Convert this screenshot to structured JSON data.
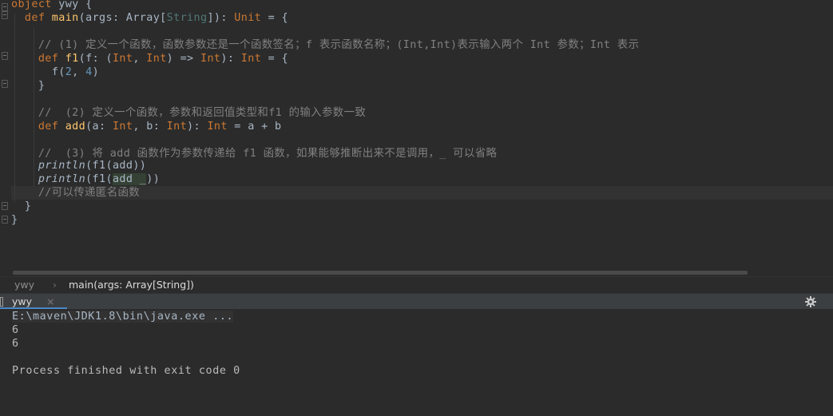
{
  "editor": {
    "lines": [
      {
        "segments": [
          {
            "t": "object",
            "c": "kw"
          },
          {
            "t": " ywy {",
            "c": "ty"
          }
        ]
      },
      {
        "segments": [
          {
            "t": "  def ",
            "c": "kw"
          },
          {
            "t": "main",
            "c": "fn"
          },
          {
            "t": "(args: Array[",
            "c": "ty"
          },
          {
            "t": "String",
            "c": "tp"
          },
          {
            "t": "]): ",
            "c": "ty"
          },
          {
            "t": "Unit",
            "c": "kw"
          },
          {
            "t": " = {",
            "c": "ty"
          }
        ]
      },
      {
        "segments": []
      },
      {
        "segments": [
          {
            "t": "    // (1) 定义一个函数，函数参数还是一个函数签名；f 表示函数名称；(Int,Int)表示输入两个 Int 参数；Int 表示",
            "c": "cm"
          }
        ]
      },
      {
        "segments": [
          {
            "t": "    def ",
            "c": "kw"
          },
          {
            "t": "f1",
            "c": "fn"
          },
          {
            "t": "(f: (",
            "c": "ty"
          },
          {
            "t": "Int",
            "c": "kw"
          },
          {
            "t": ", ",
            "c": "ty"
          },
          {
            "t": "Int",
            "c": "kw"
          },
          {
            "t": ") => ",
            "c": "ty"
          },
          {
            "t": "Int",
            "c": "kw"
          },
          {
            "t": "): ",
            "c": "ty"
          },
          {
            "t": "Int",
            "c": "kw"
          },
          {
            "t": " = {",
            "c": "ty"
          }
        ]
      },
      {
        "segments": [
          {
            "t": "      f(",
            "c": "ty"
          },
          {
            "t": "2",
            "c": "num"
          },
          {
            "t": ", ",
            "c": "ty"
          },
          {
            "t": "4",
            "c": "num"
          },
          {
            "t": ")",
            "c": "ty"
          }
        ]
      },
      {
        "segments": [
          {
            "t": "    }",
            "c": "ty"
          }
        ]
      },
      {
        "segments": []
      },
      {
        "segments": [
          {
            "t": "    //  (2) 定义一个函数，参数和返回值类型和f1 的输入参数一致",
            "c": "cm"
          }
        ]
      },
      {
        "segments": [
          {
            "t": "    def ",
            "c": "kw"
          },
          {
            "t": "add",
            "c": "fn"
          },
          {
            "t": "(a: ",
            "c": "ty"
          },
          {
            "t": "Int",
            "c": "kw"
          },
          {
            "t": ", b: ",
            "c": "ty"
          },
          {
            "t": "Int",
            "c": "kw"
          },
          {
            "t": "): ",
            "c": "ty"
          },
          {
            "t": "Int",
            "c": "kw"
          },
          {
            "t": " = a + b",
            "c": "ty"
          }
        ]
      },
      {
        "segments": []
      },
      {
        "segments": [
          {
            "t": "    //  (3) 将 add 函数作为参数传递给 f1 函数，如果能够推断出来不是调用，_ 可以省略",
            "c": "cm"
          }
        ]
      },
      {
        "segments": [
          {
            "t": "    ",
            "c": "ty"
          },
          {
            "t": "println",
            "c": "it"
          },
          {
            "t": "(f1(add))",
            "c": "ty"
          }
        ]
      },
      {
        "segments": [
          {
            "t": "    ",
            "c": "ty"
          },
          {
            "t": "println",
            "c": "it"
          },
          {
            "t": "(f1(",
            "c": "ty"
          },
          {
            "t": "add _",
            "c": "hl"
          },
          {
            "t": "))",
            "c": "ty"
          }
        ]
      },
      {
        "segments": [
          {
            "t": "    //可以传递匿名函数",
            "c": "cm"
          }
        ]
      },
      {
        "segments": [
          {
            "t": "  }",
            "c": "ty"
          }
        ]
      },
      {
        "segments": [
          {
            "t": "}",
            "c": "ty"
          }
        ]
      }
    ]
  },
  "breadcrumb": {
    "items": [
      "ywy",
      "main(args: Array[String])"
    ]
  },
  "run_panel": {
    "tab_label": "ywy",
    "close_icon": "×",
    "settings_icon": "gear-icon"
  },
  "console": {
    "command": "E:\\maven\\JDK1.8\\bin\\java.exe ...",
    "output": [
      "6",
      "6",
      "",
      "Process finished with exit code 0"
    ]
  }
}
